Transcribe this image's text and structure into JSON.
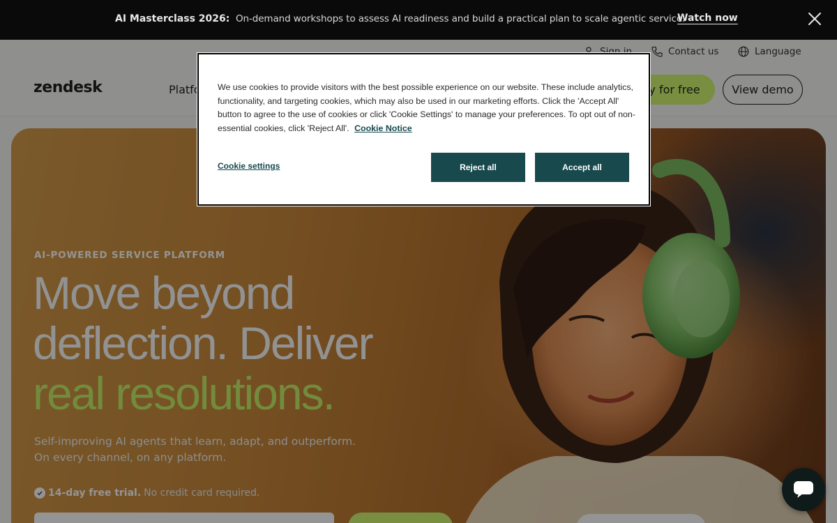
{
  "announcement": {
    "title": "AI Masterclass 2026:",
    "text": "On-demand workshops to assess AI readiness and build a practical plan to scale agentic service.",
    "link": "Watch now",
    "close_icon": "close-icon"
  },
  "header": {
    "utility": {
      "sign_in": "Sign in",
      "contact": "Contact us",
      "language": "Language"
    },
    "logo": "zendesk",
    "nav_first": "Platfo",
    "try_free": "Try for free",
    "view_demo": "View demo"
  },
  "hero": {
    "kicker": "AI-POWERED SERVICE PLATFORM",
    "headline_line1": "Move beyond",
    "headline_line2": "deflection. Deliver",
    "headline_line3": "real resolutions.",
    "sub_line1": "Self-improving AI agents that learn, adapt, and outperform.",
    "sub_line2": "On every channel, on any platform.",
    "trial_bold": "14-day free trial.",
    "trial_rest": "No credit card required."
  },
  "cookie_banner": {
    "text": "We use cookies to provide visitors with the best possible experience on our website. These include analytics, functionality, and targeting cookies, which may also be used in our marketing efforts. Click the 'Accept All' button to agree to the use of cookies or click 'Cookie Settings' to manage your preferences. To opt out of non-essential cookies, click 'Reject All'.",
    "notice_link": "Cookie Notice",
    "settings": "Cookie settings",
    "reject": "Reject all",
    "accept": "Accept all"
  },
  "colors": {
    "accent_green": "#d1f470",
    "cookie_button": "#17494d",
    "announcement_bg": "#0a0a0a"
  }
}
